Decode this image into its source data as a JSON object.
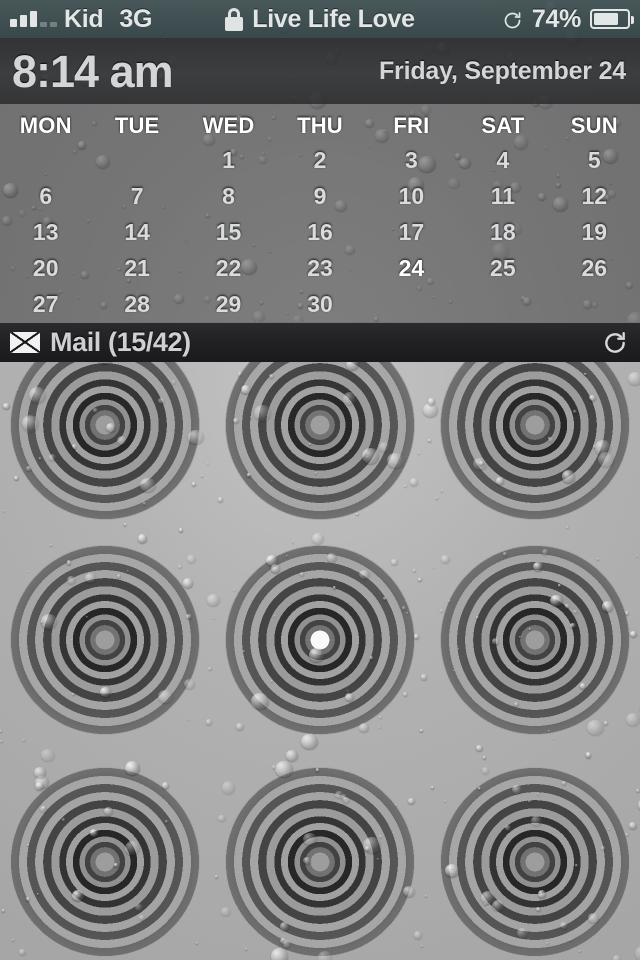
{
  "status_bar": {
    "signal_icon": "signal-bars-icon",
    "signal_bars_filled": 3,
    "signal_bars_total": 5,
    "carrier": "Kid",
    "network": "3G",
    "lock_icon": "lock-icon",
    "center_text": "Live Life Love",
    "sync_icon": "sync-icon",
    "battery_percent": "74%",
    "battery_level": 74,
    "battery_icon": "battery-icon"
  },
  "time_bar": {
    "time": "8:14 am",
    "date": "Friday, September 24"
  },
  "calendar": {
    "day_headers": [
      "MON",
      "TUE",
      "WED",
      "THU",
      "FRI",
      "SAT",
      "SUN"
    ],
    "today": "24",
    "weeks": [
      [
        "",
        "",
        "1",
        "2",
        "3",
        "4",
        "5"
      ],
      [
        "6",
        "7",
        "8",
        "9",
        "10",
        "11",
        "12"
      ],
      [
        "13",
        "14",
        "15",
        "16",
        "17",
        "18",
        "19"
      ],
      [
        "20",
        "21",
        "22",
        "23",
        "24",
        "25",
        "26"
      ],
      [
        "27",
        "28",
        "29",
        "30",
        "",
        "",
        ""
      ]
    ]
  },
  "mail_bar": {
    "envelope_icon": "envelope-icon",
    "label": "Mail (15/42)",
    "unread": 15,
    "total": 42,
    "refresh_icon": "refresh-icon"
  },
  "wallpaper": {
    "description": "water-droplets-with-ripples",
    "base_color": "#b6b6b6",
    "ripple_grid_columns": 3,
    "ripple_grid_rows": 3,
    "active_ripple_index": 5
  }
}
